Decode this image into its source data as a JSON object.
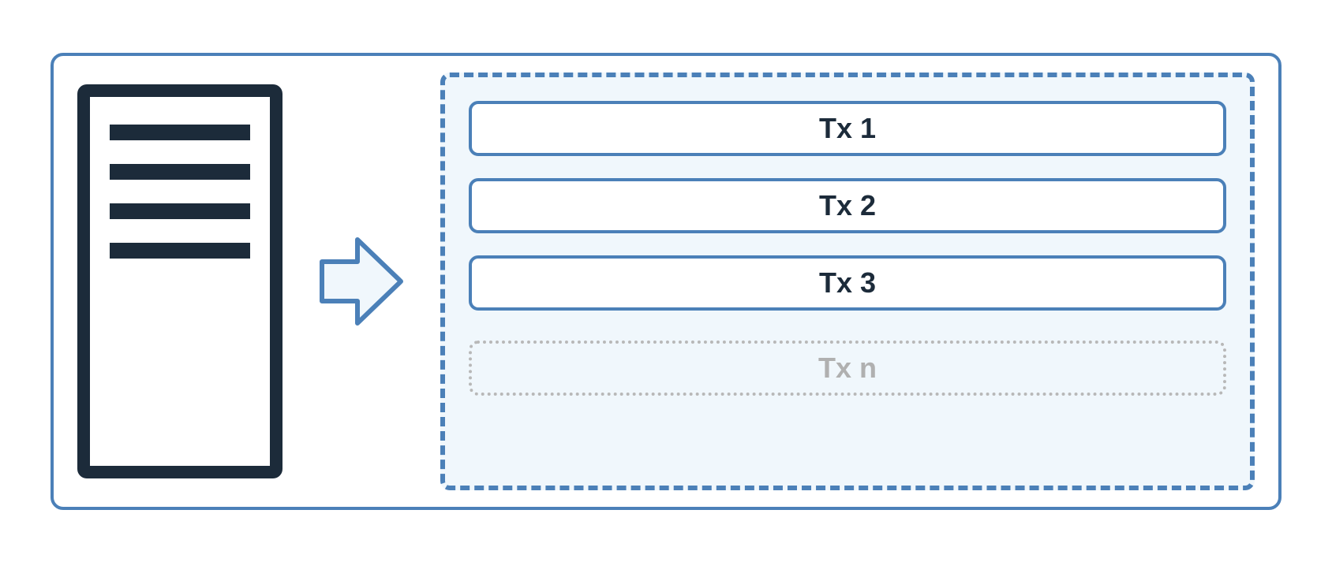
{
  "diagram": {
    "transactions": {
      "solid": [
        {
          "label": "Tx 1"
        },
        {
          "label": "Tx 2"
        },
        {
          "label": "Tx 3"
        }
      ],
      "placeholder": {
        "label": "Tx n"
      }
    }
  },
  "colors": {
    "border_blue": "#4b80b8",
    "dark_navy": "#1c2b3a",
    "light_blue_bg": "#f0f7fc",
    "gray_dotted": "#b8b8b8",
    "gray_text": "#b0b0b0"
  }
}
